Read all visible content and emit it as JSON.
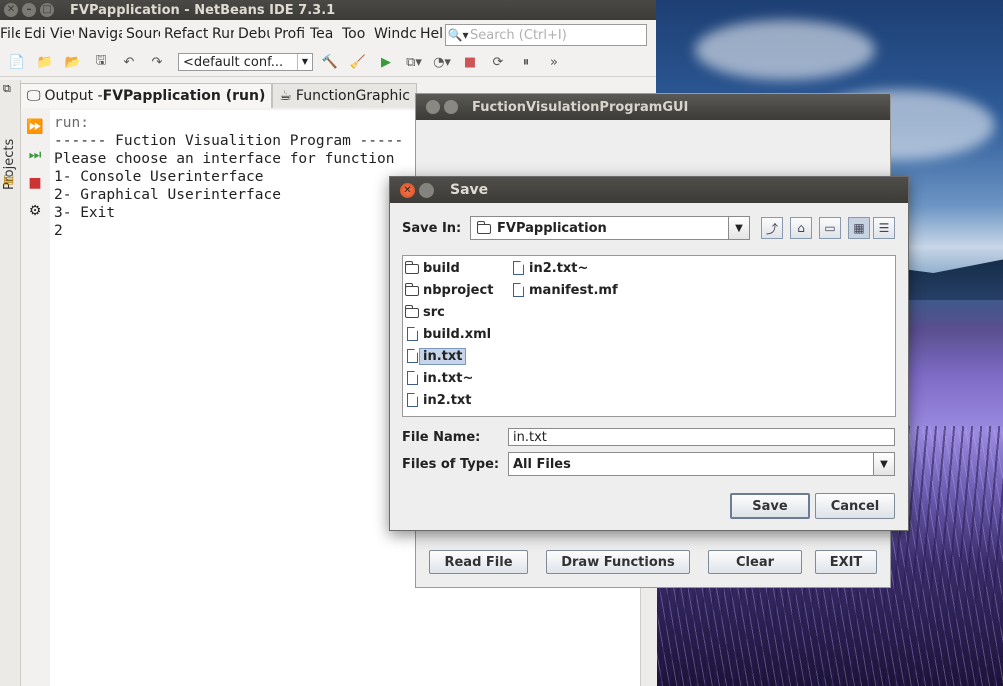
{
  "ide": {
    "window_title": "FVPapplication - NetBeans IDE 7.3.1",
    "menu": [
      "File",
      "Edit",
      "View",
      "Navigate",
      "Source",
      "Refactor",
      "Run",
      "Debug",
      "Profile",
      "Team",
      "Tools",
      "Window",
      "Help"
    ],
    "menu_visible": [
      "File",
      "Edi",
      "View",
      "Naviga",
      "Sourc",
      "Refact",
      "Rur",
      "Debu",
      "Profi",
      "Tea",
      "Too",
      "Windc",
      "Hel"
    ],
    "search_placeholder": "Search (Ctrl+I)",
    "config_value": "<default conf...",
    "projects_label": "Projects",
    "tabs": [
      {
        "prefix": "Output - ",
        "bold": "FVPapplication (run)"
      },
      {
        "prefix": "FunctionGraphic",
        "bold": ""
      }
    ],
    "output_lines": [
      "run:",
      "------ Fuction Visualition Program -----",
      "Please choose an interface for function",
      "1- Console Userinterface",
      "2- Graphical Userinterface",
      "3- Exit",
      "2"
    ]
  },
  "gui_window": {
    "title": "FuctionVisulationProgramGUI",
    "buttons": [
      "Read File",
      "Draw Functions",
      "Clear",
      "EXIT"
    ]
  },
  "save_dialog": {
    "title": "Save",
    "save_in_label": "Save In:",
    "save_in_value": "FVPapplication",
    "files_col1": [
      {
        "name": "build",
        "type": "folder"
      },
      {
        "name": "nbproject",
        "type": "folder"
      },
      {
        "name": "src",
        "type": "folder"
      },
      {
        "name": "build.xml",
        "type": "file"
      },
      {
        "name": "in.txt",
        "type": "file",
        "selected": true
      },
      {
        "name": "in.txt~",
        "type": "file"
      },
      {
        "name": "in2.txt",
        "type": "file"
      }
    ],
    "files_col2": [
      {
        "name": "in2.txt~",
        "type": "file"
      },
      {
        "name": "manifest.mf",
        "type": "file"
      }
    ],
    "file_name_label": "File Name:",
    "file_name_value": "in.txt",
    "file_type_label": "Files of Type:",
    "file_type_value": "All Files",
    "save_button": "Save",
    "cancel_button": "Cancel"
  },
  "colors": {
    "titlebar": "#3c3b37",
    "close_button": "#e2552a",
    "selection": "#c7d5ea"
  }
}
